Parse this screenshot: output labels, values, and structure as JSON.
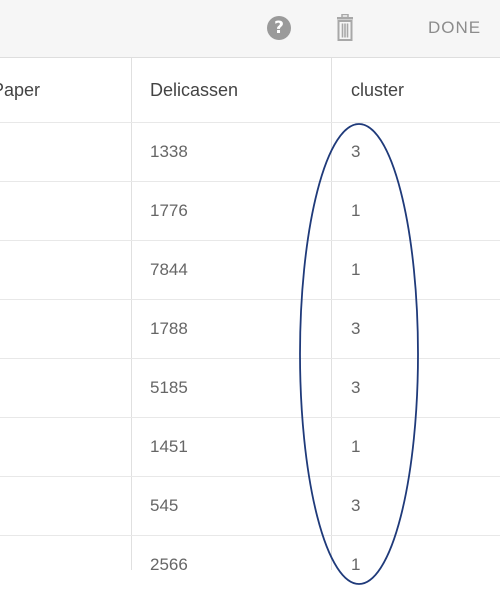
{
  "toolbar": {
    "help_glyph": "?",
    "done_label": "DONE"
  },
  "table": {
    "columns": [
      "Paper",
      "Delicassen",
      "cluster"
    ],
    "rows": [
      {
        "delicassen": "1338",
        "cluster": "3"
      },
      {
        "delicassen": "1776",
        "cluster": "1"
      },
      {
        "delicassen": "7844",
        "cluster": "1"
      },
      {
        "delicassen": "1788",
        "cluster": "3"
      },
      {
        "delicassen": "5185",
        "cluster": "3"
      },
      {
        "delicassen": "1451",
        "cluster": "1"
      },
      {
        "delicassen": "545",
        "cluster": "3"
      },
      {
        "delicassen": "2566",
        "cluster": "1"
      }
    ]
  },
  "icons": {
    "help": "question-circle-icon",
    "delete": "trash-icon"
  },
  "colors": {
    "annotation_stroke": "#1f3a7a",
    "toolbar_bg": "#f6f6f6",
    "icon_gray": "#9a9a9a"
  }
}
